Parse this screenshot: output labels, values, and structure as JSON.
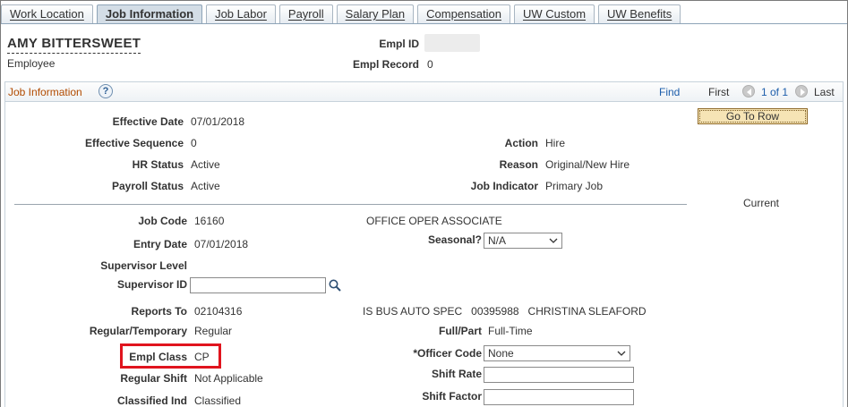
{
  "tabs": [
    {
      "label": "Work Location"
    },
    {
      "label": "Job Information"
    },
    {
      "label": "Job Labor"
    },
    {
      "label": "Payroll"
    },
    {
      "label": "Salary Plan"
    },
    {
      "label": "Compensation"
    },
    {
      "label": "UW Custom"
    },
    {
      "label": "UW Benefits"
    }
  ],
  "active_tab": "Job Information",
  "header": {
    "name": "AMY BITTERSWEET",
    "role": "Employee",
    "empl_id_label": "Empl ID",
    "empl_id_value": "",
    "empl_record_label": "Empl Record",
    "empl_record_value": "0"
  },
  "grid": {
    "title": "Job Information",
    "help_glyph": "?",
    "find": "Find",
    "first": "First",
    "page": "1 of 1",
    "last": "Last",
    "goto_row": "Go To Row",
    "status": "Current"
  },
  "fields": {
    "effective_date": {
      "label": "Effective Date",
      "value": "07/01/2018"
    },
    "effective_sequence": {
      "label": "Effective Sequence",
      "value": "0"
    },
    "hr_status": {
      "label": "HR Status",
      "value": "Active"
    },
    "payroll_status": {
      "label": "Payroll Status",
      "value": "Active"
    },
    "action": {
      "label": "Action",
      "value": "Hire"
    },
    "reason": {
      "label": "Reason",
      "value": "Original/New Hire"
    },
    "job_indicator": {
      "label": "Job Indicator",
      "value": "Primary Job"
    },
    "job_code": {
      "label": "Job Code",
      "value": "16160",
      "description": "OFFICE OPER ASSOCIATE"
    },
    "entry_date": {
      "label": "Entry Date",
      "value": "07/01/2018"
    },
    "seasonal": {
      "label": "Seasonal?",
      "value": "N/A"
    },
    "supervisor_level": {
      "label": "Supervisor Level",
      "value": ""
    },
    "supervisor_id": {
      "label": "Supervisor ID",
      "value": ""
    },
    "reports_to": {
      "label": "Reports To",
      "value": "02104316",
      "description": "IS BUS AUTO SPEC   00395988   CHRISTINA SLEAFORD"
    },
    "regular_temporary": {
      "label": "Regular/Temporary",
      "value": "Regular"
    },
    "full_part": {
      "label": "Full/Part",
      "value": "Full-Time"
    },
    "empl_class": {
      "label": "Empl Class",
      "value": "CP"
    },
    "officer_code": {
      "label": "*Officer Code",
      "value": "None"
    },
    "regular_shift": {
      "label": "Regular Shift",
      "value": "Not Applicable"
    },
    "shift_rate": {
      "label": "Shift Rate",
      "value": ""
    },
    "classified_ind": {
      "label": "Classified Ind",
      "value": "Classified"
    },
    "shift_factor": {
      "label": "Shift Factor",
      "value": ""
    }
  },
  "icons": {
    "help": "help-icon",
    "prev": "previous-arrow-icon",
    "next": "next-arrow-icon",
    "lookup": "magnifier-icon",
    "dropdown": "chevron-down-icon"
  },
  "colors": {
    "grid_title": "#b14b00",
    "link": "#1d5eab",
    "highlight_box": "#e0141e",
    "goto_button": "#f6e4b5"
  }
}
